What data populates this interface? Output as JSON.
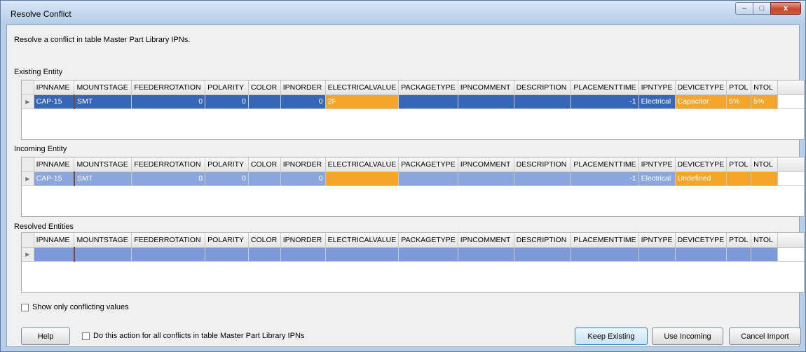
{
  "window": {
    "title": "Resolve Conflict",
    "controls": {
      "minimize": "–",
      "maximize": "□",
      "close": "x"
    }
  },
  "description": "Resolve a conflict in table Master Part Library IPNs.",
  "columns": [
    "IPNNAME",
    "MOUNTSTAGE",
    "FEEDERROTATION",
    "POLARITY",
    "COLOR",
    "IPNORDER",
    "ELECTRICALVALUE",
    "PACKAGETYPE",
    "IPNCOMMENT",
    "DESCRIPTION",
    "PLACEMENTTIME",
    "IPNTYPE",
    "DEVICETYPE",
    "PTOL",
    "NTOL"
  ],
  "existing": {
    "label": "Existing Entity",
    "row": [
      "CAP-15",
      "SMT",
      "0",
      "0",
      "",
      "0",
      "2F",
      "",
      "",
      "",
      "-1",
      "Electrical",
      "Capacitor",
      "5%",
      "5%"
    ]
  },
  "incoming": {
    "label": "Incoming Entity",
    "row": [
      "CAP-15",
      "SMT",
      "0",
      "0",
      "",
      "0",
      "",
      "",
      "",
      "",
      "-1",
      "Electrical",
      "Undefined",
      "",
      ""
    ]
  },
  "resolved": {
    "label": "Resolved Entities",
    "row": [
      "",
      "",
      "",
      "",
      "",
      "",
      "",
      "",
      "",
      "",
      "",
      "",
      "",
      "",
      ""
    ]
  },
  "row_indicator": "▶",
  "show_conflicting_label": "Show only conflicting values",
  "apply_all_label": "Do this action for all conflicts in table Master Part Library IPNs",
  "buttons": {
    "help": "Help",
    "keep_existing": "Keep Existing",
    "use_incoming": "Use Incoming",
    "cancel_import": "Cancel Import"
  },
  "colors": {
    "existing_row": "#3566b8",
    "incoming_row": "#8aa6dd",
    "resolved_row": "#7d99dc",
    "conflict_highlight": "#f5a52c"
  }
}
